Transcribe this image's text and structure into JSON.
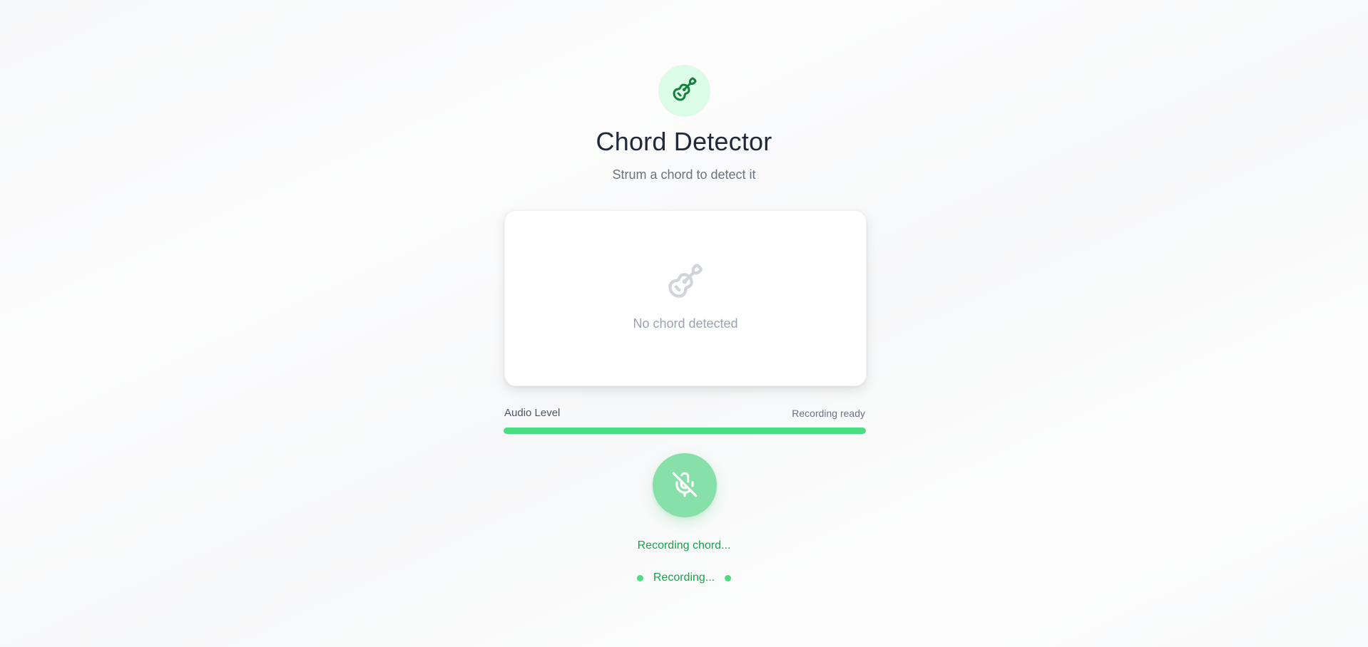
{
  "header": {
    "logo_icon": "guitar-icon",
    "title": "Chord Detector",
    "subtitle": "Strum a chord to detect it"
  },
  "chord_card": {
    "icon": "guitar-icon",
    "empty_text": "No chord detected"
  },
  "audio_level": {
    "label": "Audio Level",
    "status": "Recording ready",
    "level_percent": 100
  },
  "mic_button": {
    "icon": "mic-off-icon"
  },
  "recording": {
    "status_text": "Recording chord...",
    "indicator_text": "Recording..."
  },
  "colors": {
    "accent": "#16a34a",
    "accent_light": "#dcfce7",
    "level_fill": "#4ade80",
    "button": "#86e0a8"
  }
}
